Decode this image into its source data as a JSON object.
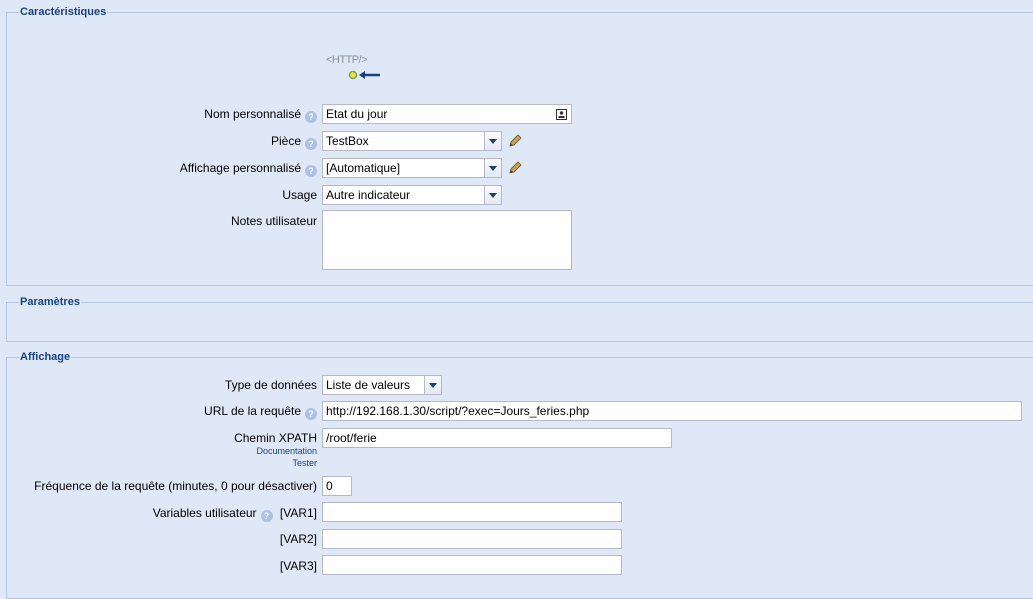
{
  "sections": {
    "caracteristiques": "Caractéristiques",
    "parametres": "Paramètres",
    "affichage": "Affichage"
  },
  "device_icon_text": "<HTTP/>",
  "fields": {
    "nom": {
      "label": "Nom personnalisé",
      "value": "Etat du jour"
    },
    "piece": {
      "label": "Pièce",
      "value": "TestBox"
    },
    "affichage_perso": {
      "label": "Affichage personnalisé",
      "value": "[Automatique]"
    },
    "usage": {
      "label": "Usage",
      "value": "Autre indicateur"
    },
    "notes": {
      "label": "Notes utilisateur",
      "value": ""
    },
    "type_donnees": {
      "label": "Type de données",
      "value": "Liste de valeurs"
    },
    "url": {
      "label": "URL de la requête",
      "value": "http://192.168.1.30/script/?exec=Jours_feries.php"
    },
    "xpath": {
      "label": "Chemin XPATH",
      "value": "/root/ferie",
      "link_doc": "Documentation",
      "link_test": "Tester"
    },
    "frequence": {
      "label": "Fréquence de la requête (minutes, 0 pour désactiver)",
      "value": "0"
    },
    "variables": {
      "label": "Variables utilisateur",
      "var1": "[VAR1]",
      "var2": "[VAR2]",
      "var3": "[VAR3]",
      "var1_value": "",
      "var2_value": "",
      "var3_value": ""
    }
  },
  "help_glyph": "?",
  "colors": {
    "background": "#dfe8f6",
    "legend": "#15428b",
    "border": "#b5c5e0"
  }
}
